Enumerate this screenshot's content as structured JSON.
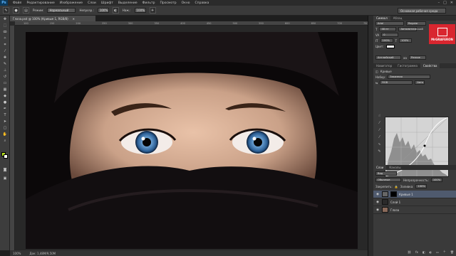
{
  "menubar": {
    "logo": "Ps",
    "items": [
      "Файл",
      "Редактирование",
      "Изображение",
      "Слои",
      "Шрифт",
      "Выделение",
      "Фильтр",
      "Просмотр",
      "Окно",
      "Справка"
    ],
    "controls": [
      "–",
      "□",
      "✕"
    ]
  },
  "options": {
    "mode_label": "Режим:",
    "mode_value": "Нормальный",
    "opacity_label": "Непрозр.:",
    "opacity_value": "100%",
    "flow_label": "Наж.:",
    "flow_value": "100%",
    "workspace": "Основная рабочая среда"
  },
  "document": {
    "tab_title": "Глаза.psd @ 100% (Кривые 1, RGB/8)",
    "zoom": "100%",
    "doc_info": "Док: 1,48M/9,50M",
    "ruler_marks": [
      "100",
      "150",
      "200",
      "250",
      "300",
      "350",
      "400",
      "450",
      "500",
      "550",
      "600",
      "650",
      "700",
      "750",
      "800"
    ]
  },
  "panels": {
    "top_tabs": [
      "Символ",
      "Абзац"
    ],
    "font_family": "Arial",
    "font_style": "Regular",
    "font_size": "48 пт",
    "leading": "Автоматический",
    "tracking": "0",
    "scale_v": "100%",
    "scale_h": "100%",
    "color_label": "Цвет:",
    "language": "Английский",
    "antialias": "Резкое",
    "props_tabs": [
      "Навигатор",
      "Гистограмма",
      "Свойства"
    ],
    "props_title": "Кривые",
    "preset_label": "Набор:",
    "preset_value": "Заказная",
    "channel_value": "RGB",
    "auto_label": "Авто",
    "layers_tabs": [
      "Слои",
      "Каналы"
    ],
    "kind_value": "Вид",
    "blend_value": "Обычные",
    "opacity_label": "Непрозрачность:",
    "opacity_value": "100%",
    "lock_label": "Закрепить:",
    "fill_label": "Заливка:",
    "fill_value": "100%",
    "layers": [
      {
        "name": "Кривые 1"
      },
      {
        "name": "Слой 1"
      },
      {
        "name": "Глаза"
      }
    ]
  },
  "watermark": {
    "text": "MrGRAFERON"
  },
  "colors": {
    "foreground": "#b8e21e",
    "background": "#ffffff",
    "selected_layer": "#4f5a6e",
    "watermark": "#d9262f"
  }
}
